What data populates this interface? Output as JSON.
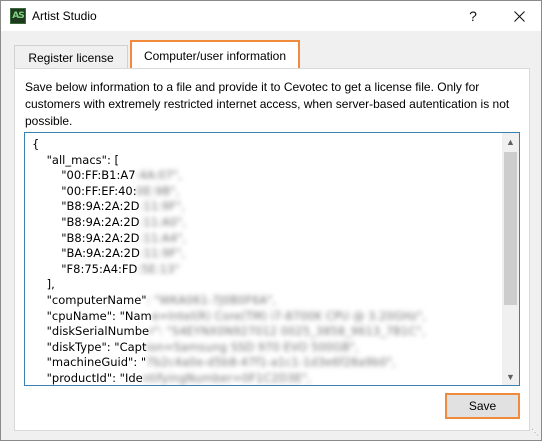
{
  "window": {
    "title": "Artist Studio",
    "app_icon_text": "AS",
    "help_label": "?"
  },
  "tabs": [
    {
      "label": "Register license",
      "active": false
    },
    {
      "label": "Computer/user information",
      "active": true
    }
  ],
  "panel": {
    "description": "Save below information to a file and provide it to Cevotec to get a license file. Only for customers with extremely restricted internet access, when server-based autentication is not possible.",
    "json_lines": [
      {
        "visible": "{",
        "hidden": ""
      },
      {
        "visible": "    \"all_macs\": [",
        "hidden": ""
      },
      {
        "visible": "        \"00:FF:B1:A7",
        "hidden": ":4A:07\","
      },
      {
        "visible": "        \"00:FF:EF:40:",
        "hidden": "0E:9B\","
      },
      {
        "visible": "        \"B8:9A:2A:2D",
        "hidden": ":11:9F\","
      },
      {
        "visible": "        \"B8:9A:2A:2D",
        "hidden": ":11:A0\","
      },
      {
        "visible": "        \"B8:9A:2A:2D",
        "hidden": ":11:A4\","
      },
      {
        "visible": "        \"BA:9A:2A:2D",
        "hidden": ":11:9F\","
      },
      {
        "visible": "        \"F8:75:A4:FD",
        "hidden": ":5E:13\""
      },
      {
        "visible": "    ],",
        "hidden": ""
      },
      {
        "visible": "    \"computerName\"",
        "hidden": ": \"WKA061-7J0B0F6A\","
      },
      {
        "visible": "    \"cpuName\": \"Nam",
        "hidden": "e=Intel(R) Core(TM) i7-8700K CPU @ 3.20GHz\","
      },
      {
        "visible": "    \"diskSerialNumbe",
        "hidden": "r\": \"S4EYNX0N927012 0025_3858_9613_7B1C\","
      },
      {
        "visible": "    \"diskType\": \"Capt",
        "hidden": "ion=Samsung SSD 970 EVO 500GB\","
      },
      {
        "visible": "    \"machineGuid\": \"",
        "hidden": "7b2c4a0e-d5b8-47f1-a1c1-1d3e6f28a9b0\","
      },
      {
        "visible": "    \"productId\": \"Ide",
        "hidden": "ntifyingNumber=0F1C2D3E\","
      }
    ],
    "save_label": "Save"
  }
}
